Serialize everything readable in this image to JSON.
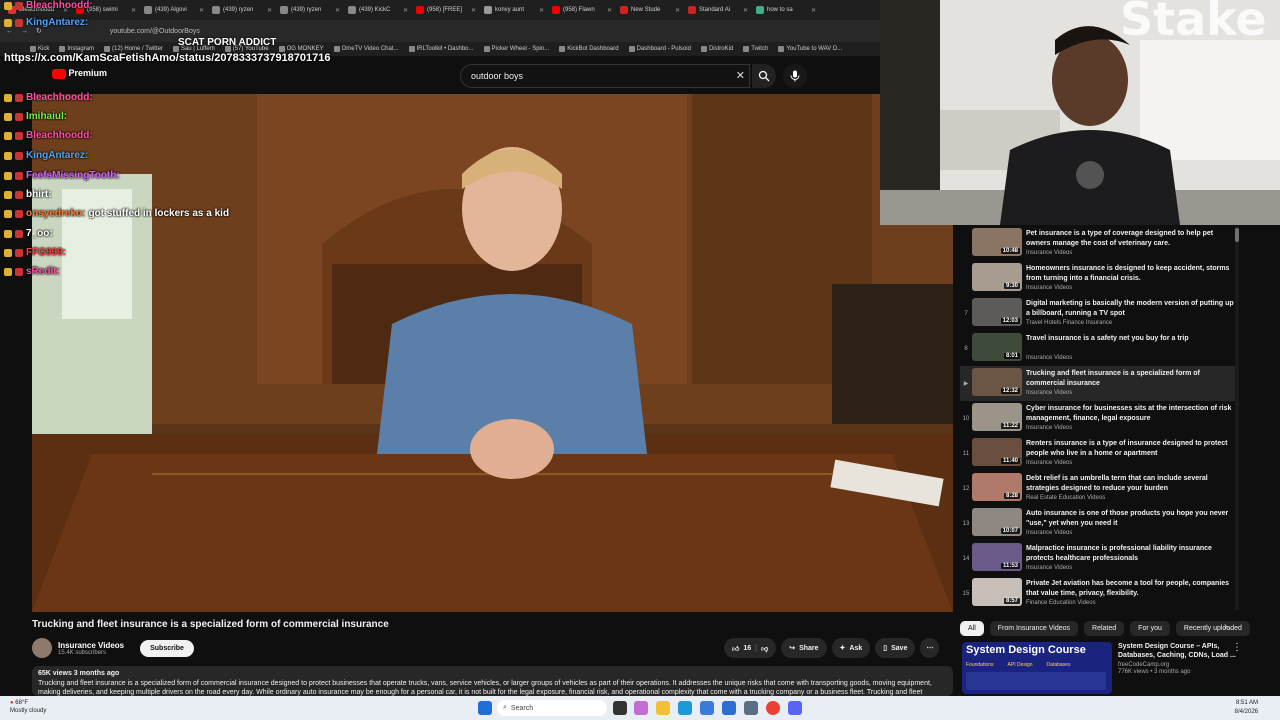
{
  "browser": {
    "tabs": [
      "Bleachhoodd",
      "(958) swimi",
      "(439) Algovi",
      "(439) ryzen",
      "(439) ryzen",
      "(439) KickC",
      "(958) [FREE]",
      "konvy aunt",
      "(958) Flawn",
      "New Stude",
      "Standard Ai",
      "how to sa"
    ],
    "address": "youtube.com/@OutdoorBoys",
    "bookmarks": [
      "Kick",
      "Instagram",
      "(12) Home / Twitter",
      "Sau | Luffem",
      "(57) YouTube",
      "OG MONKEY",
      "OmeTV Video Chat...",
      "IRLToolkit • Dashbo...",
      "Picker Wheel - Spin...",
      "KickBot Dashboard",
      "Dashboard - Pulsoid",
      "DistroKid",
      "Twitch",
      "YouTube to WAV D..."
    ]
  },
  "youtube": {
    "premium_label": "Premium",
    "search_value": "outdoor boys"
  },
  "chat_overlay": {
    "pinned_url": "https://x.com/KamScaFetishAmo/status/2078333737918701716",
    "scat_text": "SCAT PORN ADDICT",
    "messages": [
      {
        "user": "Bleachhoodd:",
        "text": "",
        "color": "#ff4fa3"
      },
      {
        "user": "KingAntarez:",
        "text": "",
        "color": "#4fa3ff"
      },
      {
        "user": "Bleachhoodd:",
        "text": "",
        "color": "#ff4fa3"
      },
      {
        "user": "Imihaiul:",
        "text": "",
        "color": "#6cf04a"
      },
      {
        "user": "Bleachhoodd:",
        "text": "",
        "color": "#ff4fa3"
      },
      {
        "user": "KingAntarez:",
        "text": "",
        "color": "#4fa3ff"
      },
      {
        "user": "FeefsMissingTooth:",
        "text": "",
        "color": "#d85cff"
      },
      {
        "user": "bhirt:",
        "text": "",
        "color": "#ffffff"
      },
      {
        "user": "onsyedreko:",
        "text": "got stuffed in lockers as a kid",
        "color": "#ff7a2f"
      },
      {
        "user": "7_oo:",
        "text": "",
        "color": "#ffffff"
      },
      {
        "user": "FFG999:",
        "text": "",
        "color": "#ff3b3b"
      },
      {
        "user": "sRedit:",
        "text": "",
        "color": "#ff4fa3"
      }
    ]
  },
  "video": {
    "title": "Trucking and fleet insurance is a specialized form of commercial insurance",
    "channel_name": "Insurance Videos",
    "subscribers": "15.4K subscribers",
    "subscribe_label": "Subscribe",
    "likes": "16",
    "share_label": "Share",
    "ask_label": "Ask",
    "save_label": "Save",
    "views_date": "65K views  3 months ago",
    "description": "Trucking and fleet insurance is a specialized form of commercial insurance designed to protect businesses that operate trucks, vans, service vehicles, or larger groups of vehicles as part of their operations. It addresses the unique risks that come with transporting goods, moving equipment, making deliveries, and keeping multiple drivers on the road every day. While ordinary auto insurance may be enough for a personal car, it is not built for the legal exposure, financial risk, and operational complexity that come with a trucking company or a business fleet. Trucking and fleet"
  },
  "playlist": [
    {
      "num": "",
      "duration": "10:48",
      "title": "Pet insurance is a type of coverage designed to help pet owners manage the cost of veterinary care.",
      "channel": "Insurance Videos"
    },
    {
      "num": "",
      "duration": "9:30",
      "title": "Homeowners insurance is designed to keep accident, storms from turning into a financial crisis.",
      "channel": "Insurance Videos"
    },
    {
      "num": "7",
      "duration": "12:03",
      "title": "Digital marketing is basically the modern version of putting up a billboard, running a TV spot",
      "channel": "Travel Hotels Finance Insurance"
    },
    {
      "num": "8",
      "duration": "8:01",
      "title": "Travel insurance is a safety net you buy for a trip",
      "channel": "Insurance Videos"
    },
    {
      "num": "▶",
      "duration": "12:32",
      "title": "Trucking and fleet insurance is a specialized form of commercial insurance",
      "channel": "Insurance Videos"
    },
    {
      "num": "10",
      "duration": "11:22",
      "title": "Cyber insurance for businesses sits at the intersection of risk management, finance, legal exposure",
      "channel": "Insurance Videos"
    },
    {
      "num": "11",
      "duration": "11:40",
      "title": "Renters insurance is a type of insurance designed to protect people who live in a home or apartment",
      "channel": "Insurance Videos"
    },
    {
      "num": "12",
      "duration": "8:28",
      "title": "Debt relief is an umbrella term that can include several strategies designed to reduce your burden",
      "channel": "Real Estate Education Videos"
    },
    {
      "num": "13",
      "duration": "10:07",
      "title": "Auto insurance is one of those products you hope you never \"use,\" yet when you need it",
      "channel": "Insurance Videos"
    },
    {
      "num": "14",
      "duration": "11:53",
      "title": "Malpractice insurance is professional liability insurance protects healthcare professionals",
      "channel": "Insurance Videos"
    },
    {
      "num": "15",
      "duration": "8:57",
      "title": "Private Jet aviation has become a tool for people, companies that value time, privacy, flexibility.",
      "channel": "Finance Education Videos"
    }
  ],
  "chips": [
    "All",
    "From Insurance Videos",
    "Related",
    "For you",
    "Recently uploaded"
  ],
  "ad": {
    "title": "System Design Course – APIs, Databases, Caching, CDNs, Load ...",
    "channel": "freeCodeCamp.org",
    "meta": "776K views • 3 months ago",
    "thumb_title": "System Design Course",
    "thumb_tags": [
      "Foundations",
      "API Design",
      "Databases"
    ]
  },
  "taskbar": {
    "weather_temp": "68°F",
    "weather_desc": "Mostly cloudy",
    "search_label": "Search",
    "time": "8:51 AM",
    "date": "8/4/2026"
  },
  "webcam": {
    "sign_text": "Stake"
  }
}
